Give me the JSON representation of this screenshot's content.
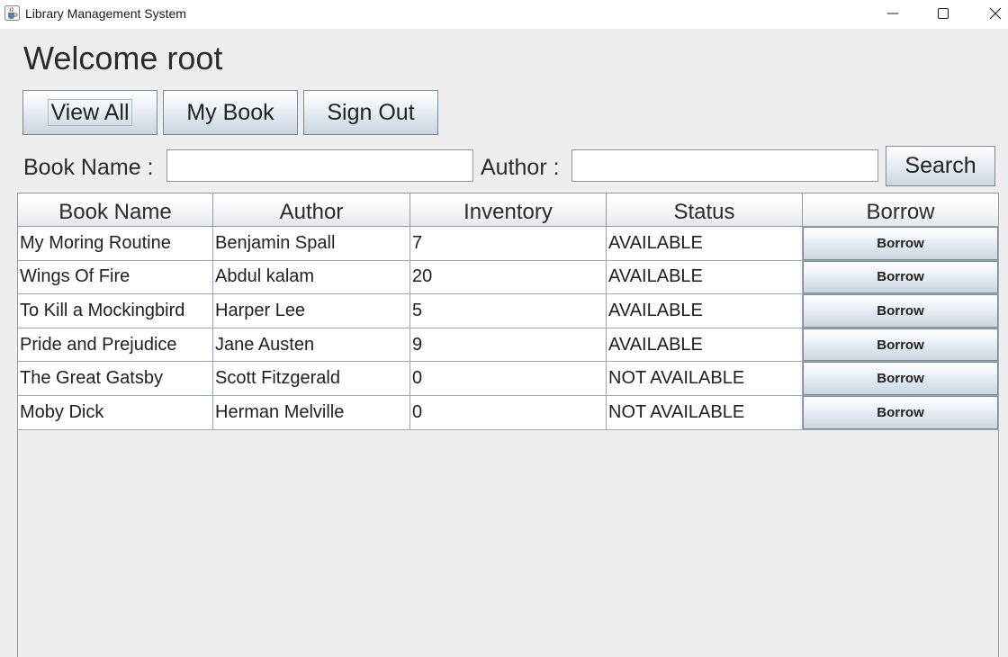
{
  "window": {
    "title": "Library Management System"
  },
  "header": {
    "welcome": "Welcome root"
  },
  "nav": {
    "view_all": "View All",
    "my_book": "My Book",
    "sign_out": "Sign Out"
  },
  "search": {
    "book_name_label": "Book Name :",
    "book_name_value": "",
    "author_label": "Author :",
    "author_value": "",
    "button": "Search"
  },
  "table": {
    "columns": [
      "Book Name",
      "Author",
      "Inventory",
      "Status",
      "Borrow"
    ],
    "rows": [
      {
        "name": "My Moring Routine",
        "author": "Benjamin Spall",
        "inventory": "7",
        "status": "AVAILABLE",
        "borrow": "Borrow"
      },
      {
        "name": "Wings Of Fire",
        "author": "Abdul kalam",
        "inventory": "20",
        "status": "AVAILABLE",
        "borrow": "Borrow"
      },
      {
        "name": "To Kill a Mockingbird",
        "author": "Harper Lee",
        "inventory": "5",
        "status": "AVAILABLE",
        "borrow": "Borrow"
      },
      {
        "name": "Pride and Prejudice",
        "author": "Jane Austen",
        "inventory": "9",
        "status": "AVAILABLE",
        "borrow": "Borrow"
      },
      {
        "name": "The Great Gatsby",
        "author": "Scott Fitzgerald",
        "inventory": "0",
        "status": "NOT AVAILABLE",
        "borrow": "Borrow"
      },
      {
        "name": "Moby Dick",
        "author": "Herman Melville",
        "inventory": "0",
        "status": "NOT AVAILABLE",
        "borrow": "Borrow"
      }
    ]
  },
  "icons": {
    "app": "java-cup-icon",
    "minimize": "minimize-icon",
    "maximize": "maximize-icon",
    "close": "close-icon"
  },
  "colors": {
    "background": "#eeeeee",
    "button_gradient_top": "#ffffff",
    "button_gradient_bottom": "#c9d5e0",
    "border": "#8e9aa5"
  }
}
